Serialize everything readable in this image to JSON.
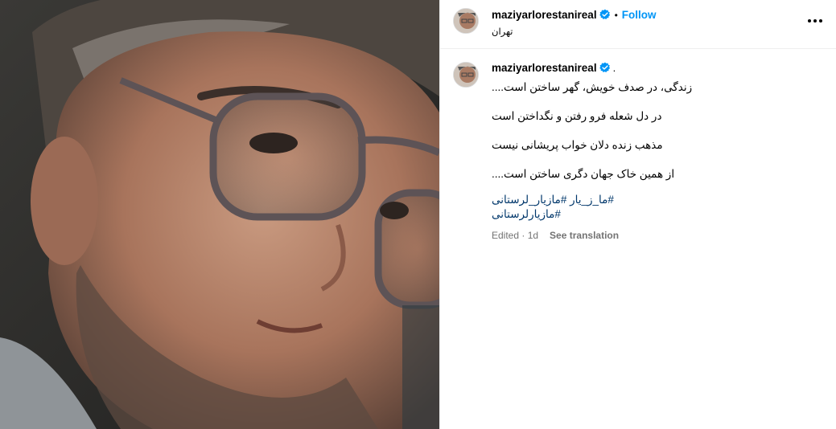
{
  "post": {
    "username": "maziyarlorestanireal",
    "location": "تهران",
    "follow_label": "Follow",
    "separator": "•",
    "verified": true,
    "accent_color": "#0095f6",
    "hashtag_color": "#00376b"
  },
  "caption": {
    "username": "maziyarlorestanireal",
    "trailing": ".",
    "lines": [
      "زندگی، در صدف خویش، گهر ساختن است....",
      "در دل شعله فرو رفتن و نگداختن است",
      "مذهب زنده دلان خواب پریشانی نیست",
      "از همین خاک جهان دگری ساختن است...."
    ],
    "hashtags": [
      "#ما_ز_یار #مازیار_لرستانی",
      "#مازیارلرستانی"
    ],
    "edited": "Edited · 1d",
    "see_translation": "See translation"
  },
  "icons": {
    "more": "more-options-icon",
    "verified": "verified-badge-icon"
  }
}
